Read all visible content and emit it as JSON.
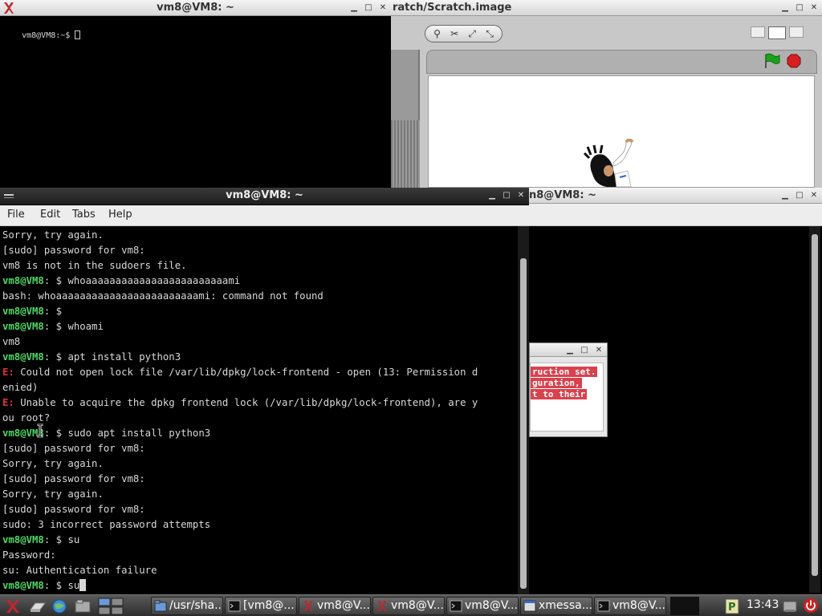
{
  "windows": {
    "top_left_terminal": {
      "title": "vm8@VM8: ~",
      "prompt_line": "vm8@VM8:~$ "
    },
    "scratch": {
      "title": "ratch/Scratch.image"
    },
    "main_terminal": {
      "title": "vm8@VM8: ~",
      "menu": [
        "File",
        "Edit",
        "Tabs",
        "Help"
      ]
    },
    "right_terminal": {
      "title": "n8@VM8: ~"
    },
    "xmessage": {
      "lines": [
        "ruction set.",
        "guration,",
        "t to their"
      ]
    }
  },
  "terminal_lines": [
    {
      "type": "out",
      "text": "Sorry, try again."
    },
    {
      "type": "out",
      "text": "[sudo] password for vm8:"
    },
    {
      "type": "out",
      "text": "vm8 is not in the sudoers file."
    },
    {
      "type": "cmd",
      "prompt": "vm8@VM8",
      "rest": ": $ whoaaaaaaaaaaaaaaaaaaaaaaaami"
    },
    {
      "type": "out",
      "text": "bash: whoaaaaaaaaaaaaaaaaaaaaaaaami: command not found"
    },
    {
      "type": "cmd",
      "prompt": "vm8@VM8",
      "rest": ": $"
    },
    {
      "type": "cmd",
      "prompt": "vm8@VM8",
      "rest": ": $ whoami"
    },
    {
      "type": "out",
      "text": "vm8"
    },
    {
      "type": "cmd",
      "prompt": "vm8@VM8",
      "rest": ": $ apt install python3"
    },
    {
      "type": "err",
      "prefix": "E:",
      "text": " Could not open lock file /var/lib/dpkg/lock-frontend - open (13: Permission d"
    },
    {
      "type": "out",
      "text": "enied)"
    },
    {
      "type": "err",
      "prefix": "E:",
      "text": " Unable to acquire the dpkg frontend lock (/var/lib/dpkg/lock-frontend), are y"
    },
    {
      "type": "out",
      "text": "ou root?"
    },
    {
      "type": "cmd",
      "prompt": "vm8@VM8",
      "rest": ": $ sudo apt install python3"
    },
    {
      "type": "out",
      "text": "[sudo] password for vm8:"
    },
    {
      "type": "out",
      "text": "Sorry, try again."
    },
    {
      "type": "out",
      "text": "[sudo] password for vm8:"
    },
    {
      "type": "out",
      "text": "Sorry, try again."
    },
    {
      "type": "out",
      "text": "[sudo] password for vm8:"
    },
    {
      "type": "out",
      "text": "sudo: 3 incorrect password attempts"
    },
    {
      "type": "cmd",
      "prompt": "vm8@VM8",
      "rest": ": $ su"
    },
    {
      "type": "out",
      "text": "Password:"
    },
    {
      "type": "out",
      "text": "su: Authentication failure"
    },
    {
      "type": "cmd",
      "prompt": "vm8@VM8",
      "rest": ": $ su",
      "cursor": true
    }
  ],
  "taskbar": {
    "tasks": [
      {
        "label": "/usr/sha...",
        "icon": "folder-icon"
      },
      {
        "label": "[vm8@...",
        "icon": "terminal-icon"
      },
      {
        "label": "vm8@V...",
        "icon": "x-app-icon"
      },
      {
        "label": "vm8@V...",
        "icon": "x-app-icon"
      },
      {
        "label": "vm8@V...",
        "icon": "terminal-icon"
      },
      {
        "label": "xmessa...",
        "icon": "window-icon"
      },
      {
        "label": "vm8@V...",
        "icon": "terminal-icon"
      }
    ],
    "clock": "13:43"
  },
  "colors": {
    "prompt": "#4cd964",
    "error": "#e03030",
    "terminal_bg": "#000000",
    "stop_sign": "#d81e1e",
    "green_flag": "#1aa31a"
  }
}
